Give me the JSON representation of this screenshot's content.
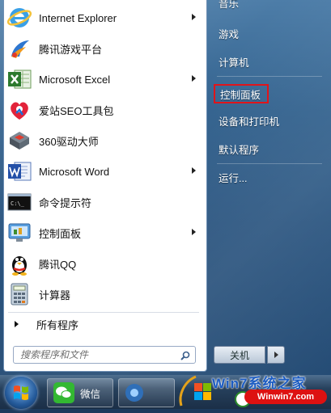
{
  "programs": [
    {
      "label": "Internet Explorer",
      "icon": "internet-explorer-icon",
      "has_submenu": true
    },
    {
      "label": "腾讯游戏平台",
      "icon": "tencent-game-icon",
      "has_submenu": false
    },
    {
      "label": "Microsoft Excel",
      "icon": "excel-icon",
      "has_submenu": true
    },
    {
      "label": "爱站SEO工具包",
      "icon": "seo-toolkit-icon",
      "has_submenu": false
    },
    {
      "label": "360驱动大师",
      "icon": "driver-master-icon",
      "has_submenu": false
    },
    {
      "label": "Microsoft Word",
      "icon": "word-icon",
      "has_submenu": true
    },
    {
      "label": "命令提示符",
      "icon": "command-prompt-icon",
      "has_submenu": false
    },
    {
      "label": "控制面板",
      "icon": "control-panel-icon",
      "has_submenu": true
    },
    {
      "label": "腾讯QQ",
      "icon": "qq-penguin-icon",
      "has_submenu": false
    },
    {
      "label": "计算器",
      "icon": "calculator-icon",
      "has_submenu": false
    }
  ],
  "all_programs_label": "所有程序",
  "search": {
    "placeholder": "搜索程序和文件"
  },
  "right_items": [
    {
      "label": "音乐"
    },
    {
      "label": "游戏"
    },
    {
      "label": "计算机"
    },
    {
      "label": "控制面板",
      "highlighted": true
    },
    {
      "label": "设备和打印机"
    },
    {
      "label": "默认程序"
    },
    {
      "label": "运行..."
    }
  ],
  "shutdown_label": "关机",
  "taskbar": {
    "wechat_label": "微信"
  },
  "watermark": {
    "title": "Win7系统之家",
    "url": "Winwin7.com"
  },
  "colors": {
    "highlight_border": "#e0141a",
    "watermark_blue": "#1c5cc2",
    "watermark_red": "#dd1111"
  }
}
